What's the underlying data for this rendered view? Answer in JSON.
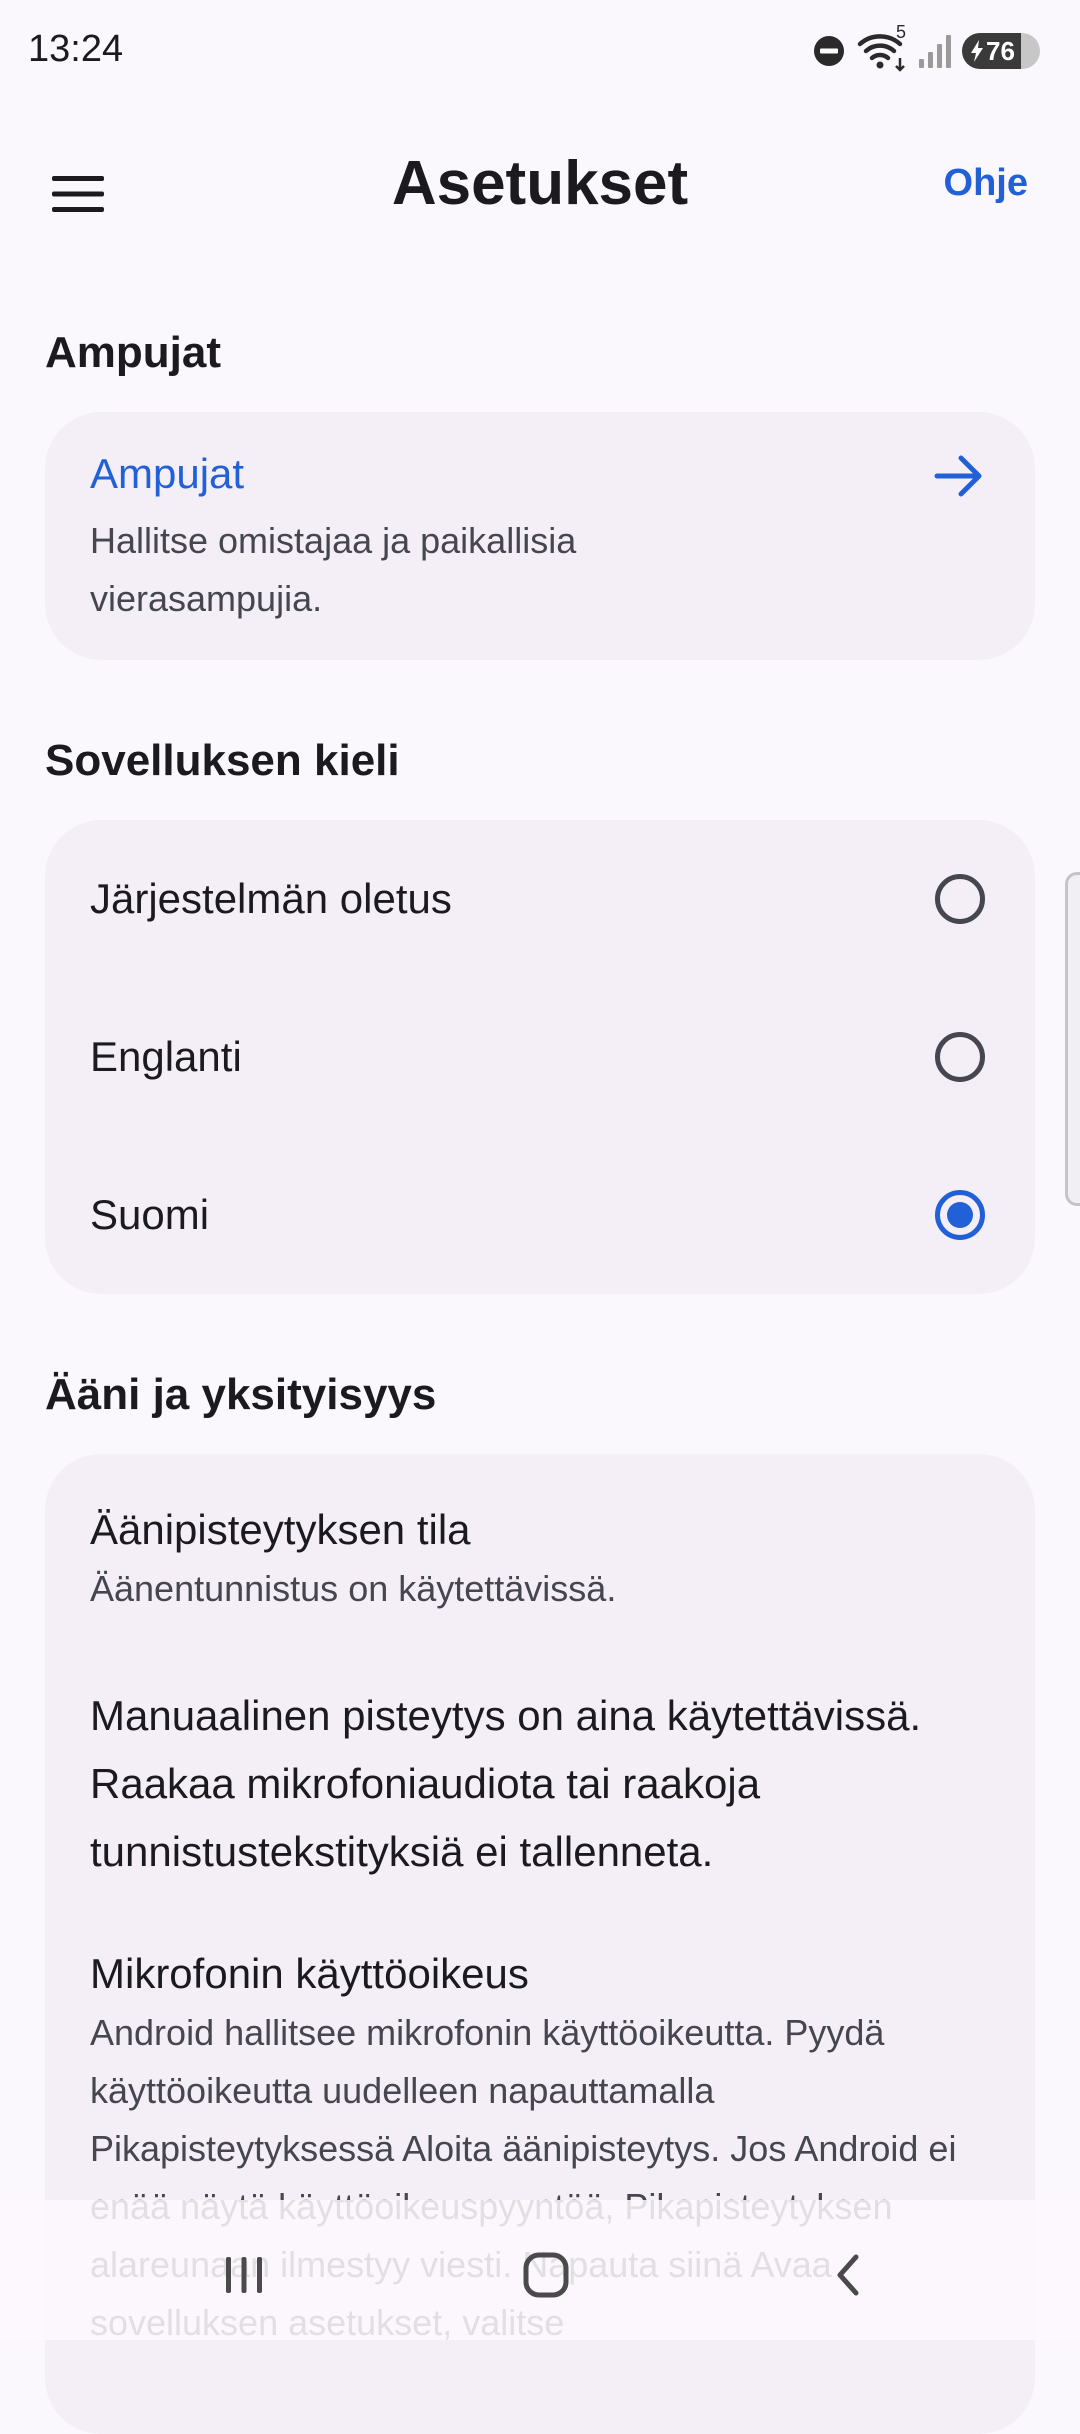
{
  "status_bar": {
    "time": "13:24",
    "wifi_badge": "5",
    "battery_percent": 76,
    "battery_label": "76",
    "icons": [
      "do-not-disturb-icon",
      "wifi-icon",
      "signal-icon",
      "battery-charging-icon"
    ]
  },
  "header": {
    "menu_icon": "hamburger-menu-icon",
    "title": "Asetukset",
    "help_label": "Ohje"
  },
  "sections": {
    "shooters": {
      "header": "Ampujat",
      "card_title": "Ampujat",
      "card_description": "Hallitse omistajaa ja paikallisia vierasampujia.",
      "card_icon": "arrow-right-icon"
    },
    "language": {
      "header": "Sovelluksen kieli",
      "options": [
        {
          "label": "Järjestelmän oletus",
          "selected": false
        },
        {
          "label": "Englanti",
          "selected": false
        },
        {
          "label": "Suomi",
          "selected": true
        }
      ]
    },
    "privacy": {
      "header": "Ääni ja yksityisyys",
      "voice_scoring_title": "Äänipisteytyksen tila",
      "voice_scoring_status": "Äänentunnistus on käytettävissä.",
      "manual_note": "Manuaalinen pisteytys on aina käytettävissä. Raakaa mikrofoniaudiota tai raakoja tunnistustekstityksiä ei tallenneta.",
      "mic_title": "Mikrofonin käyttöoikeus",
      "mic_description": "Android hallitsee mikrofonin käyttöoikeutta. Pyydä käyttöoikeutta uudelleen napauttamalla Pikapisteytyksessä Aloita äänipisteytys. Jos Android ei enää näytä käyttöoikeuspyyntöä, Pikapisteytyksen alareunaan ilmestyy viesti. Napauta siinä Avaa sovelluksen asetukset, valitse"
    }
  },
  "nav_bar": {
    "icons": [
      "recent-apps-icon",
      "home-icon",
      "back-icon"
    ]
  },
  "colors": {
    "accent": "#2160d6",
    "background": "#fbf8fd",
    "card": "#f4eff6",
    "text_primary": "#1b1b1f",
    "text_secondary": "#45464f"
  }
}
